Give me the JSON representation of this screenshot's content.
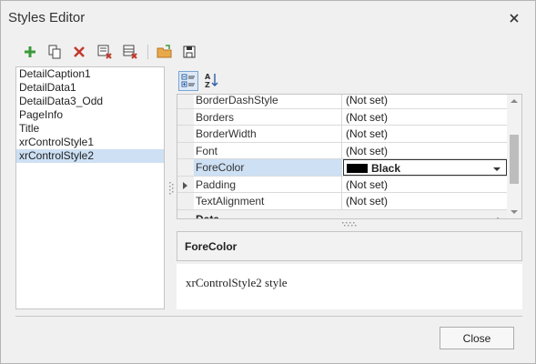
{
  "window": {
    "title": "Styles Editor"
  },
  "toolbar": {
    "buttons": [
      {
        "icon": "add-icon"
      },
      {
        "icon": "copy-icon"
      },
      {
        "icon": "delete-icon"
      },
      {
        "icon": "purge-icon"
      },
      {
        "icon": "clear-icon"
      },
      {
        "icon": "open-folder-icon"
      },
      {
        "icon": "save-icon"
      }
    ]
  },
  "styles_list": {
    "items": [
      "DetailCaption1",
      "DetailData1",
      "DetailData3_Odd",
      "PageInfo",
      "Title",
      "xrControlStyle1",
      "xrControlStyle2"
    ],
    "selected": "xrControlStyle2"
  },
  "property_grid": {
    "view_buttons": [
      {
        "icon": "categorized-icon",
        "active": true
      },
      {
        "icon": "alphabetical-sort-icon",
        "active": false
      }
    ],
    "rows": [
      {
        "name": "BorderDashStyle",
        "value": "(Not set)"
      },
      {
        "name": "Borders",
        "value": "(Not set)"
      },
      {
        "name": "BorderWidth",
        "value": "(Not set)"
      },
      {
        "name": "Font",
        "value": "(Not set)"
      },
      {
        "name": "ForeColor",
        "value": "Black",
        "selected": true,
        "swatch": "#000000"
      },
      {
        "name": "Padding",
        "value": "(Not set)",
        "expandable": true
      },
      {
        "name": "TextAlignment",
        "value": "(Not set)"
      }
    ],
    "category": "Data"
  },
  "description": {
    "title": "ForeColor",
    "text": "xrControlStyle2 style"
  },
  "footer": {
    "close_label": "Close"
  },
  "colors": {
    "selection": "#cde0f4",
    "add_green": "#3a9a3a",
    "delete_red": "#c0392b",
    "folder": "#e8a94a"
  }
}
